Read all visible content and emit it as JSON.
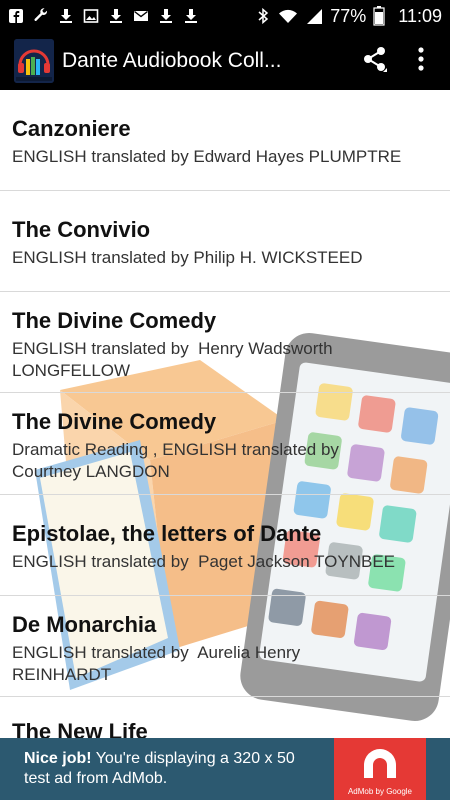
{
  "status_bar": {
    "battery": "77%",
    "time": "11:09",
    "icons": [
      "facebook-icon",
      "wrench-icon",
      "download-icon",
      "image-icon",
      "download-icon",
      "mail-icon",
      "download-icon",
      "download-icon",
      "bluetooth-icon",
      "wifi-icon",
      "signal-icon",
      "battery-icon"
    ]
  },
  "action_bar": {
    "title": "Dante Audiobook Coll...",
    "share_icon": "share-icon",
    "overflow_icon": "more-vert-icon",
    "background": "#000000"
  },
  "list": {
    "items": [
      {
        "title": "Canzoniere",
        "subtitle": "ENGLISH translated by Edward Hayes PLUMPTRE"
      },
      {
        "title": "The Convivio",
        "subtitle": "ENGLISH translated by Philip H. WICKSTEED"
      },
      {
        "title": "The Divine Comedy",
        "subtitle": "ENGLISH translated by  Henry Wadsworth LONGFELLOW"
      },
      {
        "title": "The Divine Comedy",
        "subtitle": "Dramatic Reading , ENGLISH translated by Courtney LANGDON"
      },
      {
        "title": "Epistolae, the letters of Dante",
        "subtitle": "ENGLISH translated by  Paget Jackson TOYNBEE"
      },
      {
        "title": "De Monarchia",
        "subtitle": "ENGLISH translated by  Aurelia Henry REINHARDT"
      },
      {
        "title": "The New Life",
        "subtitle": ""
      }
    ]
  },
  "ad": {
    "headline": "Nice job!",
    "body": " You're displaying a 320 x 50 test ad from AdMob.",
    "logo_caption": "AdMob by Google",
    "background": "#2c5970",
    "logo_color": "#e53935"
  }
}
